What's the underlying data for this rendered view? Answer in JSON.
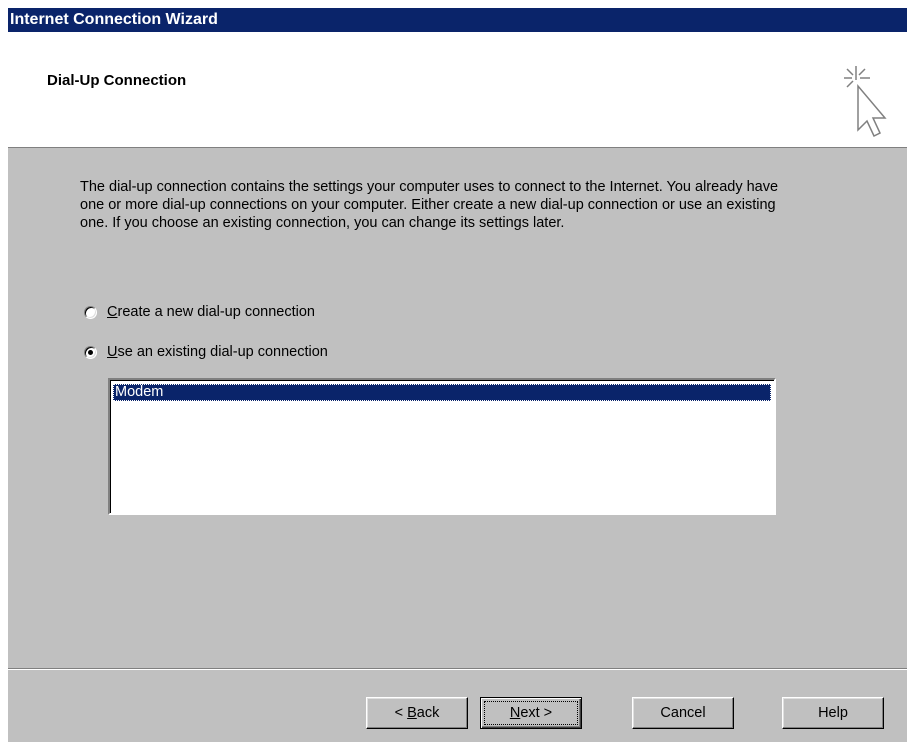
{
  "window": {
    "title": "Internet Connection Wizard"
  },
  "header": {
    "title": "Dial-Up Connection",
    "icon": "wizard-cursor-icon"
  },
  "body": {
    "description": "The dial-up connection contains the settings your computer uses to connect to the Internet. You already have one or more dial-up connections on your computer. Either create a new dial-up connection or use an existing one. If you choose an existing connection, you can change its settings later.",
    "options": [
      {
        "accel": "C",
        "rest": "reate a new dial-up connection",
        "selected": false
      },
      {
        "accel": "U",
        "rest": "se an existing dial-up connection",
        "selected": true
      }
    ],
    "connections": [
      "Modem"
    ],
    "selected_connection": "Modem"
  },
  "buttons": {
    "back": {
      "prefix": "< ",
      "accel": "B",
      "rest": "ack"
    },
    "next": {
      "accel": "N",
      "rest": "ext >"
    },
    "cancel": "Cancel",
    "help": "Help"
  },
  "colors": {
    "titlebar": "#0a246a",
    "dialog_bg": "#c0c0c0",
    "selection": "#0a246a"
  }
}
